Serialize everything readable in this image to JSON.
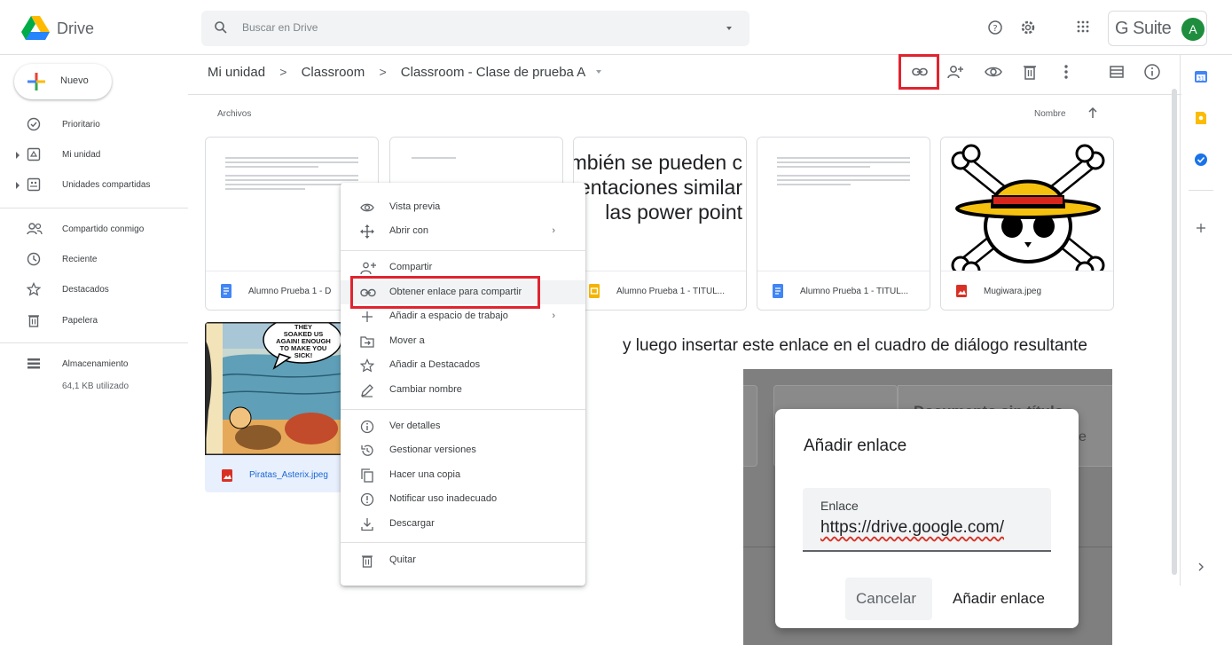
{
  "header": {
    "brand": "Drive",
    "search_placeholder": "Buscar en Drive",
    "gsuite_label": "G Suite",
    "avatar_initial": "A"
  },
  "sidebar": {
    "new_label": "Nuevo",
    "items": [
      {
        "label": "Prioritario",
        "icon": "priority-icon"
      },
      {
        "label": "Mi unidad",
        "icon": "my-drive-icon"
      },
      {
        "label": "Unidades compartidas",
        "icon": "shared-drives-icon"
      },
      {
        "label": "Compartido conmigo",
        "icon": "shared-with-me-icon"
      },
      {
        "label": "Reciente",
        "icon": "clock-icon"
      },
      {
        "label": "Destacados",
        "icon": "star-icon"
      },
      {
        "label": "Papelera",
        "icon": "trash-icon"
      },
      {
        "label": "Almacenamiento",
        "icon": "storage-icon"
      }
    ],
    "storage_used": "64,1 KB utilizado"
  },
  "breadcrumb": {
    "items": [
      "Mi unidad",
      "Classroom",
      "Classroom - Clase de prueba A"
    ],
    "separator": ">"
  },
  "files": {
    "heading": "Archivos",
    "sort_label": "Nombre",
    "cards": [
      {
        "name": "Alumno Prueba 1 - D",
        "type": "doc"
      },
      {
        "name": "",
        "type": "doc"
      },
      {
        "name": "Alumno Prueba 1 - TÍTUL...",
        "type": "slides",
        "thumb_text": "mbién se pueden c\nentaciones similar\nlas power point"
      },
      {
        "name": "Alumno Prueba 1 - TÍTUL...",
        "type": "doc"
      },
      {
        "name": "Mugiwara.jpeg",
        "type": "image"
      }
    ],
    "asterix": {
      "name": "Piratas_Asterix.jpeg",
      "bubble": "THEY\nSOAKED US\nAGAIN! ENOUGH\nTO MAKE YOU\nSICK!"
    }
  },
  "context_menu": {
    "items": [
      {
        "label": "Vista previa",
        "icon": "eye-icon"
      },
      {
        "label": "Abrir con",
        "icon": "open-with-icon",
        "submenu": "›"
      },
      {
        "label": "Compartir",
        "icon": "add-person-icon"
      },
      {
        "label": "Obtener enlace para compartir",
        "icon": "link-icon"
      },
      {
        "label": "Añadir a espacio de trabajo",
        "icon": "plus-icon",
        "submenu": "›"
      },
      {
        "label": "Mover a",
        "icon": "move-to-icon"
      },
      {
        "label": "Añadir a Destacados",
        "icon": "star-icon"
      },
      {
        "label": "Cambiar nombre",
        "icon": "pencil-icon"
      },
      {
        "label": "Ver detalles",
        "icon": "info-icon"
      },
      {
        "label": "Gestionar versiones",
        "icon": "history-icon"
      },
      {
        "label": "Hacer una copia",
        "icon": "copy-icon"
      },
      {
        "label": "Notificar uso inadecuado",
        "icon": "report-icon"
      },
      {
        "label": "Descargar",
        "icon": "download-icon"
      },
      {
        "label": "Quitar",
        "icon": "trash-icon"
      }
    ]
  },
  "caption": "y luego insertar este enlace en el cuadro de diálogo resultante",
  "dialog": {
    "bg_title": "Documento sin título",
    "bg_sub": "e",
    "title": "Añadir enlace",
    "field_label": "Enlace",
    "field_value": "https://drive.google.com/",
    "cancel_label": "Cancelar",
    "add_label": "Añadir enlace"
  },
  "colors": {
    "highlight_red": "#e0242f",
    "avatar_green": "#1e8e3e",
    "doc_blue": "#4285f4",
    "slides_yellow": "#f4b400",
    "image_red": "#d93025"
  }
}
